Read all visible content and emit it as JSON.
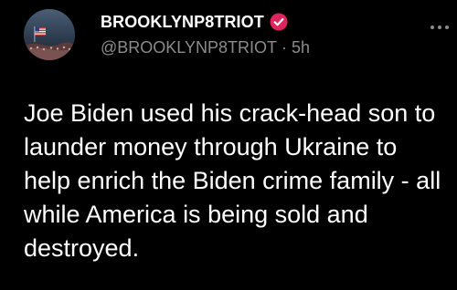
{
  "post": {
    "display_name": "BROOKLYNP8TRIOT",
    "handle": "@BROOKLYNP8TRIOT",
    "separator": "·",
    "timestamp": "5h",
    "verified_icon": "verified-badge-icon",
    "more_icon": "more-options-icon",
    "text": "Joe Biden used his crack-head son to launder money through Ukraine to help enrich the Biden crime family - all while America is being sold and destroyed."
  },
  "colors": {
    "background": "#000000",
    "text": "#ffffff",
    "secondary_text": "#8b8b8b",
    "verified_badge": "#e0245e"
  }
}
